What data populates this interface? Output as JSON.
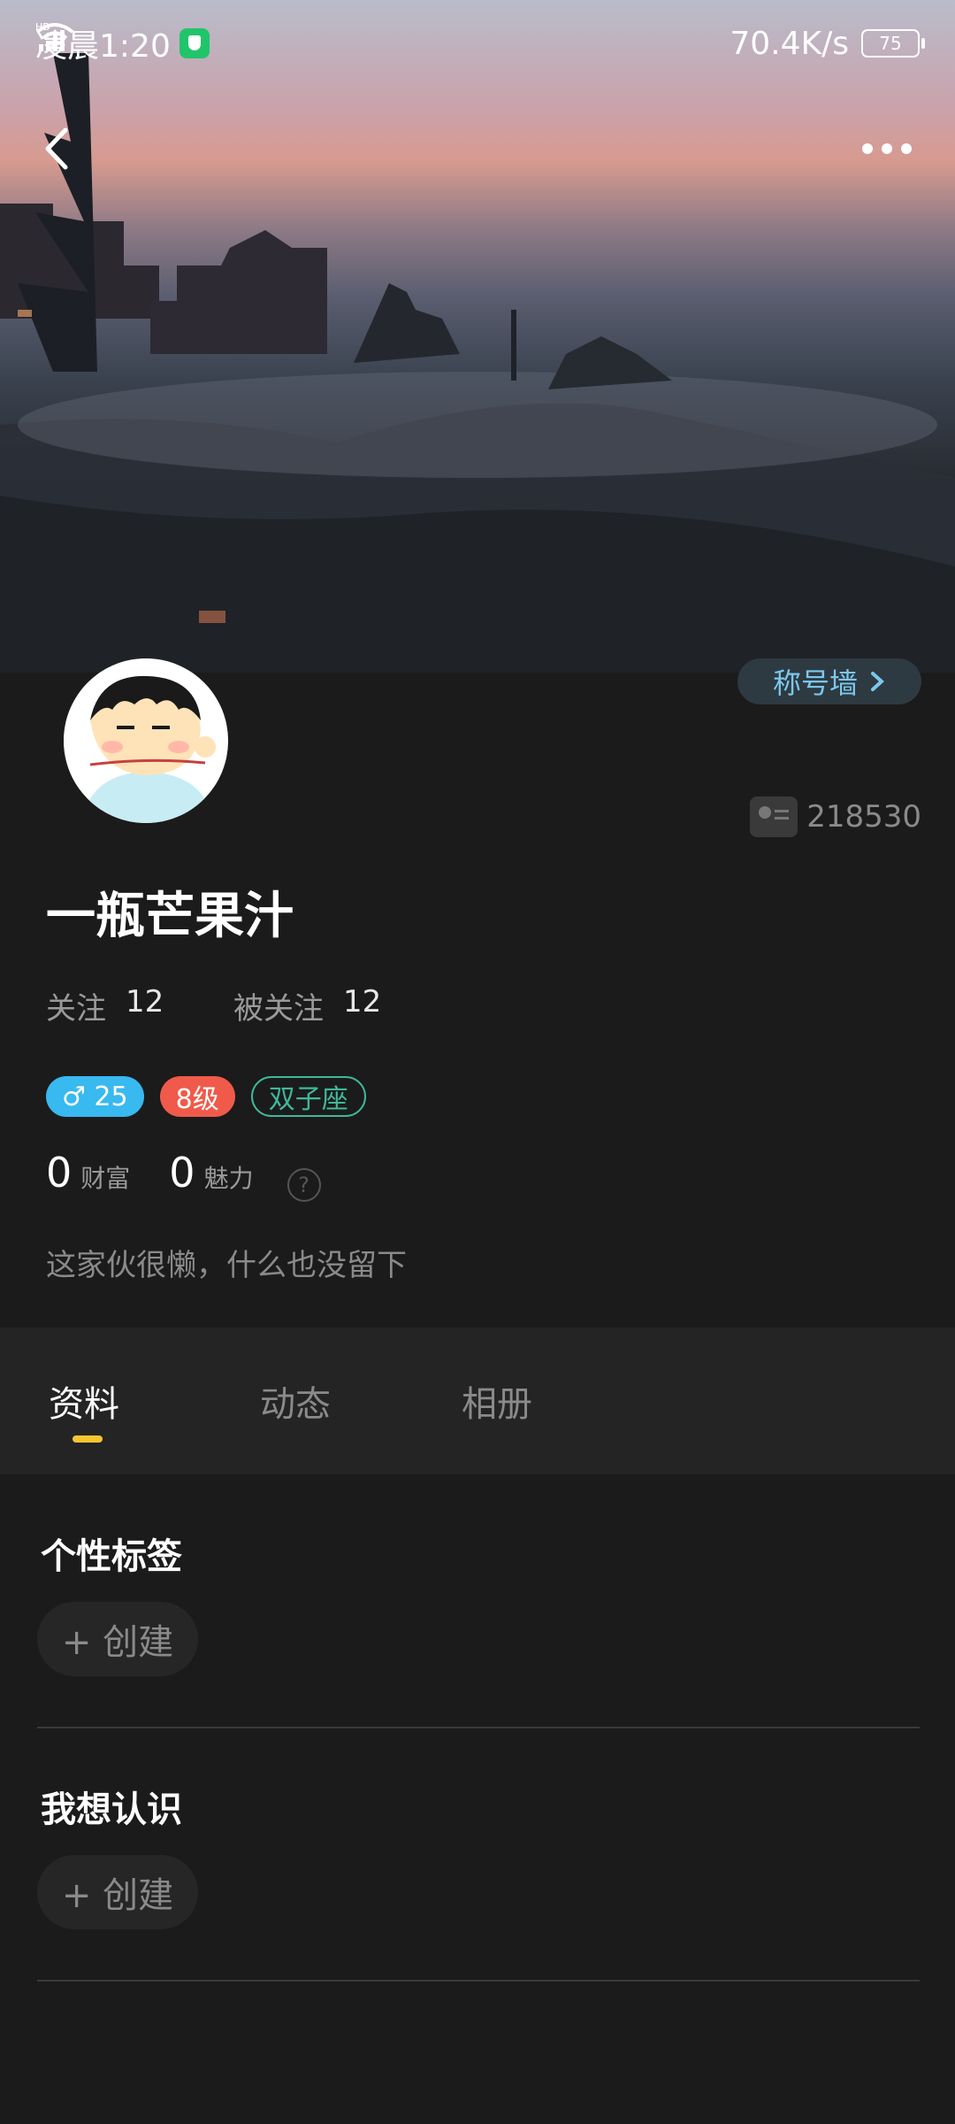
{
  "status_bar": {
    "time": "凌晨1:20",
    "network_speed": "70.4K/s",
    "signal_1_label": "HD",
    "signal_2_label": "HD",
    "battery": "75"
  },
  "header": {
    "back_icon": "back-arrow-icon",
    "more_icon": "more-dots-icon"
  },
  "profile": {
    "title_wall_label": "称号墙",
    "user_id": "218530",
    "nickname": "一瓶芒果汁",
    "following_label": "关注",
    "following_count": "12",
    "followers_label": "被关注",
    "followers_count": "12",
    "age_badge": "♂ 25",
    "level_badge": "8级",
    "zodiac_badge": "双子座",
    "wealth_value": "0",
    "wealth_label": "财富",
    "charm_value": "0",
    "charm_label": "魅力",
    "help_icon": "?",
    "bio": "这家伙很懒，什么也没留下"
  },
  "tabs": [
    {
      "label": "资料",
      "active": true
    },
    {
      "label": "动态",
      "active": false
    },
    {
      "label": "相册",
      "active": false
    }
  ],
  "sections": {
    "tags_title": "个性标签",
    "tags_create": "+ 创建",
    "meet_title": "我想认识",
    "meet_create": "+ 创建"
  },
  "colors": {
    "accent_indicator": "#f7c531",
    "age_badge": "#38b9f0",
    "level_badge": "#f05a4a",
    "zodiac_badge": "#3fb89a",
    "title_wall_text": "#7cc7ee"
  }
}
